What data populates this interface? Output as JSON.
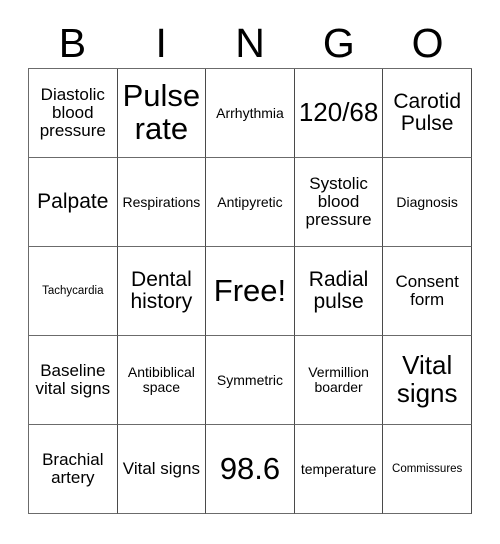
{
  "card": {
    "header_letters": [
      "B",
      "I",
      "N",
      "G",
      "O"
    ],
    "free_space_label": "Free!",
    "colors": {
      "background": "#ffffff",
      "text": "#000000",
      "grid_line": "#6b6b6b"
    },
    "rows": [
      [
        {
          "label": "Diastolic blood pressure",
          "size": "md"
        },
        {
          "label": "Pulse rate",
          "size": "xxl"
        },
        {
          "label": "Arrhythmia",
          "size": "sm"
        },
        {
          "label": "120/68",
          "size": "xl"
        },
        {
          "label": "Carotid Pulse",
          "size": "lg"
        }
      ],
      [
        {
          "label": "Palpate",
          "size": "lg"
        },
        {
          "label": "Respirations",
          "size": "sm"
        },
        {
          "label": "Antipyretic",
          "size": "sm"
        },
        {
          "label": "Systolic blood pressure",
          "size": "md"
        },
        {
          "label": "Diagnosis",
          "size": "sm"
        }
      ],
      [
        {
          "label": "Tachycardia",
          "size": "xs"
        },
        {
          "label": "Dental history",
          "size": "lg"
        },
        {
          "label": "Free!",
          "size": "xxl"
        },
        {
          "label": "Radial pulse",
          "size": "lg"
        },
        {
          "label": "Consent form",
          "size": "md"
        }
      ],
      [
        {
          "label": "Baseline vital signs",
          "size": "md"
        },
        {
          "label": "Antibiblical space",
          "size": "sm"
        },
        {
          "label": "Symmetric",
          "size": "sm"
        },
        {
          "label": "Vermillion boarder",
          "size": "sm"
        },
        {
          "label": "Vital signs",
          "size": "xl"
        }
      ],
      [
        {
          "label": "Brachial artery",
          "size": "md"
        },
        {
          "label": "Vital signs",
          "size": "md"
        },
        {
          "label": "98.6",
          "size": "xxl"
        },
        {
          "label": "temperature",
          "size": "sm"
        },
        {
          "label": "Commissures",
          "size": "xs"
        }
      ]
    ]
  }
}
